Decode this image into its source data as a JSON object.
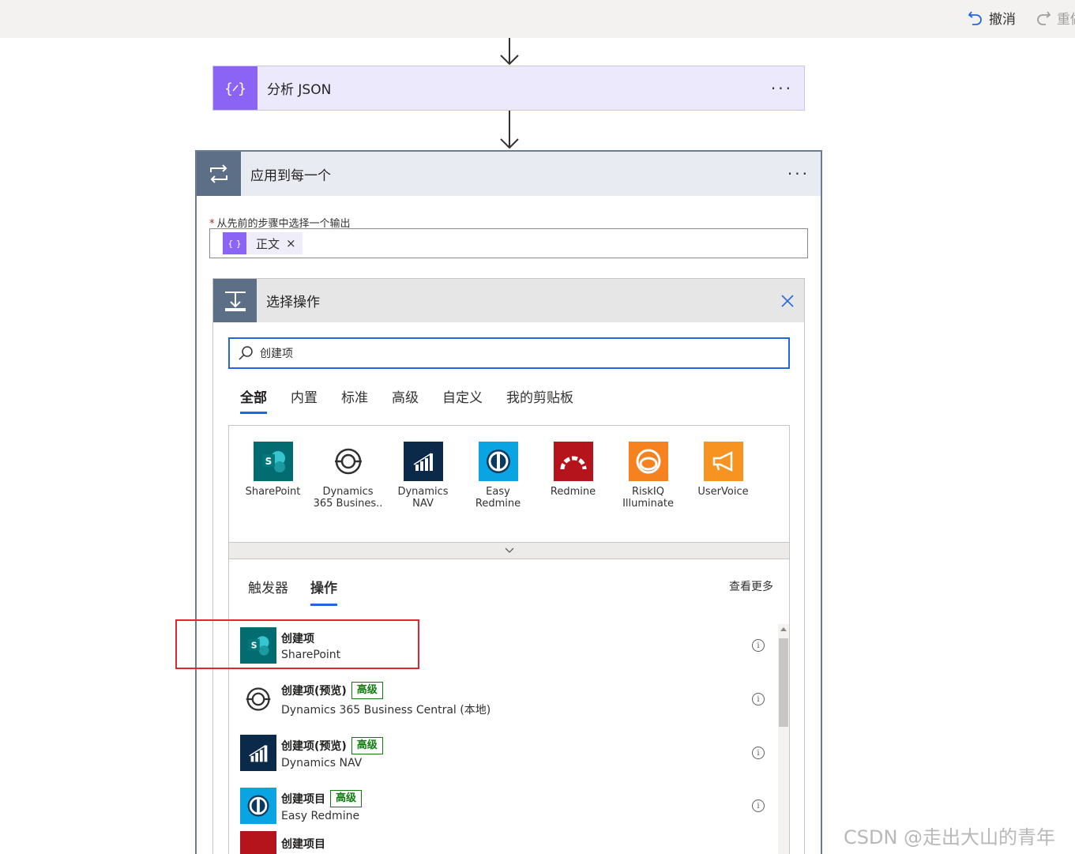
{
  "topbar": {
    "undo_label": "撤消",
    "redo_label": "重做"
  },
  "json_step": {
    "title": "分析 JSON",
    "more": "···",
    "icon": "json-braces-icon"
  },
  "foreach_step": {
    "title": "应用到每一个",
    "more": "···",
    "field_required": "*",
    "field_label": "从先前的步骤中选择一个输出",
    "token_label": "正文",
    "token_remove": "×"
  },
  "select_action": {
    "title": "选择操作",
    "search_value": "创建项",
    "tabs": [
      {
        "label": "全部",
        "active": true
      },
      {
        "label": "内置",
        "active": false
      },
      {
        "label": "标准",
        "active": false
      },
      {
        "label": "高级",
        "active": false
      },
      {
        "label": "自定义",
        "active": false
      },
      {
        "label": "我的剪贴板",
        "active": false
      }
    ],
    "connectors": [
      {
        "line1": "SharePoint",
        "line2": "",
        "color": "#036c70"
      },
      {
        "line1": "Dynamics",
        "line2": "365 Busines..",
        "color": "#ffffff"
      },
      {
        "line1": "Dynamics",
        "line2": "NAV",
        "color": "#0b2a4a"
      },
      {
        "line1": "Easy",
        "line2": "Redmine",
        "color": "#0aa4e3"
      },
      {
        "line1": "Redmine",
        "line2": "",
        "color": "#b5141c"
      },
      {
        "line1": "RiskIQ",
        "line2": "Illuminate",
        "color": "#f6821f"
      },
      {
        "line1": "UserVoice",
        "line2": "",
        "color": "#f79421"
      }
    ],
    "subtabs": [
      {
        "label": "触发器",
        "active": false
      },
      {
        "label": "操作",
        "active": true
      }
    ],
    "see_more": "查看更多",
    "actions": [
      {
        "name": "创建项",
        "badge": "",
        "connector": "SharePoint"
      },
      {
        "name": "创建项(预览)",
        "badge": "高级",
        "connector": "Dynamics 365 Business Central (本地)"
      },
      {
        "name": "创建项(预览)",
        "badge": "高级",
        "connector": "Dynamics NAV"
      },
      {
        "name": "创建项目",
        "badge": "高级",
        "connector": "Easy Redmine"
      },
      {
        "name": "创建项目",
        "badge": "",
        "connector": ""
      }
    ]
  },
  "watermark": "CSDN @走出大山的青年"
}
